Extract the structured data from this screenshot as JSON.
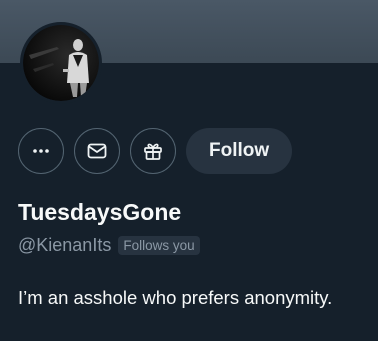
{
  "profile": {
    "display_name": "TuesdaysGone",
    "handle": "@KienanIts",
    "follows_you_badge": "Follows you",
    "bio": "I’m an asshole who prefers anonymity."
  },
  "actions": {
    "more_icon": "more-horizontal-icon",
    "message_icon": "envelope-icon",
    "gift_icon": "gift-icon",
    "follow_label": "Follow"
  },
  "colors": {
    "background": "#15202b",
    "banner": "#3f4c58",
    "button_border": "#536471",
    "follow_button_bg": "#273340",
    "secondary_text": "#8b98a5",
    "primary_text": "#f7f9f9"
  }
}
